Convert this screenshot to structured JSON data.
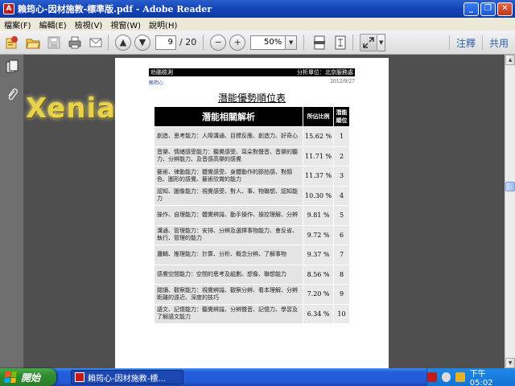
{
  "window": {
    "title": "賴筠心-因材施教-標準版.pdf - Adobe Reader",
    "app_icon_letter": "A",
    "minimize": "_",
    "restore": "❐",
    "close": "✕"
  },
  "menu": [
    "檔案(F)",
    "編輯(E)",
    "檢視(V)",
    "視窗(W)",
    "說明(H)"
  ],
  "toolbar": {
    "page_current": "9",
    "page_total": "/ 20",
    "zoom": "50%",
    "annotate_label": "注釋",
    "share_label": "共用"
  },
  "watermark": "Xenia",
  "document": {
    "header_left": "劝腦檢測",
    "header_right": "分析單位：北京服務處",
    "name": "賴筠心",
    "date": "2012/9/27",
    "title": "潛能優勢順位表",
    "table": {
      "headers": [
        "潛能相關解析",
        "所佔比例",
        "潛能順位"
      ],
      "rows": [
        {
          "ability": "創造、思考能力：人際溝通、目標反應、創造力、好奇心",
          "percent": "15.62 %",
          "rank": "1"
        },
        {
          "ability": "音樂、情緒感受能力：聽覺感受、耳朵對聲音、音樂的聽力、分辨能力、及音感高樂的感覺",
          "percent": "11.71 %",
          "rank": "2"
        },
        {
          "ability": "藝術、律動能力：體覺感受、身體動作的節拍感、對顏色、圖形的感覺、藝術欣賞的能力",
          "percent": "11.37 %",
          "rank": "3"
        },
        {
          "ability": "認知、圖像能力：視覺感受、對人、事、物聯想、認知能力",
          "percent": "10.30 %",
          "rank": "4"
        },
        {
          "ability": "操作、自理能力：體覺辨識、動手操作、操控理解、分辨",
          "percent": "9.81 %",
          "rank": "5"
        },
        {
          "ability": "溝通、管理能力：安排、分辨及選擇事物能力、會反省、執行、管理的能力",
          "percent": "9.72 %",
          "rank": "6"
        },
        {
          "ability": "邏輯、推理能力：計算、分析、概念分辨、了解事物",
          "percent": "9.37 %",
          "rank": "7"
        },
        {
          "ability": "感覺空間能力：空間的思考及組劃、想像、聯想能力",
          "percent": "8.56 %",
          "rank": "8"
        },
        {
          "ability": "閱讀、觀察能力：視覺辨識、觀察分辨、看本理解、分辨距離的遠近、深度的技巧",
          "percent": "7.20 %",
          "rank": "9"
        },
        {
          "ability": "語文、記憶能力：聽覺辨識、分辨聲音、記憶力、學習及了解語文能力",
          "percent": "6.34 %",
          "rank": "10"
        }
      ]
    }
  },
  "taskbar": {
    "start_label": "開始",
    "task_label": "賴筠心-因材施教-標...",
    "clock": "下午 05:02"
  }
}
